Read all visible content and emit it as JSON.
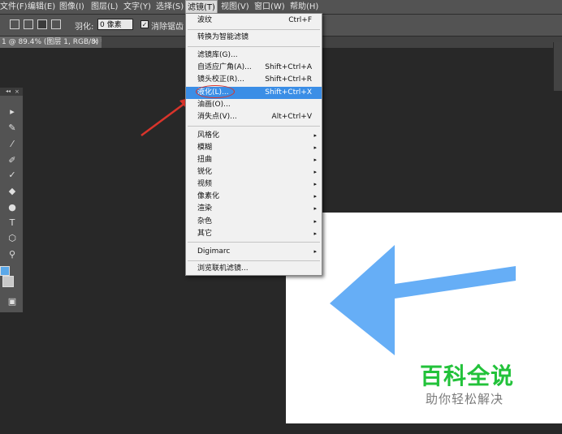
{
  "menubar": {
    "items": [
      "文件(F)",
      "编辑(E)",
      "图像(I)",
      "图层(L)",
      "文字(Y)",
      "选择(S)",
      "滤镜(T)",
      "视图(V)",
      "窗口(W)",
      "帮助(H)"
    ],
    "active_index": 6
  },
  "options": {
    "feather_label": "羽化:",
    "feather_value": "0 像素",
    "antialias_label": "消除锯齿",
    "antialias_checked": "✓"
  },
  "document": {
    "tab_title": "1 @ 89.4% (图层 1, RGB/8) *",
    "tab_close": "×"
  },
  "toolbox": {
    "collapse": "◂◂",
    "close": "×"
  },
  "filter_menu": {
    "items": [
      {
        "label": "波纹",
        "shortcut": "Ctrl+F"
      },
      {
        "label": "转换为智能滤镜"
      },
      {
        "label": "滤镜库(G)..."
      },
      {
        "label": "自适应广角(A)...",
        "shortcut": "Shift+Ctrl+A"
      },
      {
        "label": "镜头校正(R)...",
        "shortcut": "Shift+Ctrl+R"
      },
      {
        "label": "液化(L)...",
        "shortcut": "Shift+Ctrl+X",
        "highlighted": true
      },
      {
        "label": "油画(O)..."
      },
      {
        "label": "消失点(V)...",
        "shortcut": "Alt+Ctrl+V"
      },
      {
        "label": "风格化",
        "submenu": "▸"
      },
      {
        "label": "模糊",
        "submenu": "▸"
      },
      {
        "label": "扭曲",
        "submenu": "▸"
      },
      {
        "label": "锐化",
        "submenu": "▸"
      },
      {
        "label": "视频",
        "submenu": "▸"
      },
      {
        "label": "像素化",
        "submenu": "▸"
      },
      {
        "label": "渲染",
        "submenu": "▸"
      },
      {
        "label": "杂色",
        "submenu": "▸"
      },
      {
        "label": "其它",
        "submenu": "▸"
      },
      {
        "label": "Digimarc",
        "submenu": "▸"
      },
      {
        "label": "浏览联机滤镜..."
      }
    ]
  },
  "watermark": {
    "title": "百科全说",
    "subtitle": "助你轻松解决"
  },
  "colors": {
    "accent": "#3b8ee6",
    "annotation": "#d9342b",
    "arrow": "#66aef6",
    "watermark": "#22c23a"
  }
}
